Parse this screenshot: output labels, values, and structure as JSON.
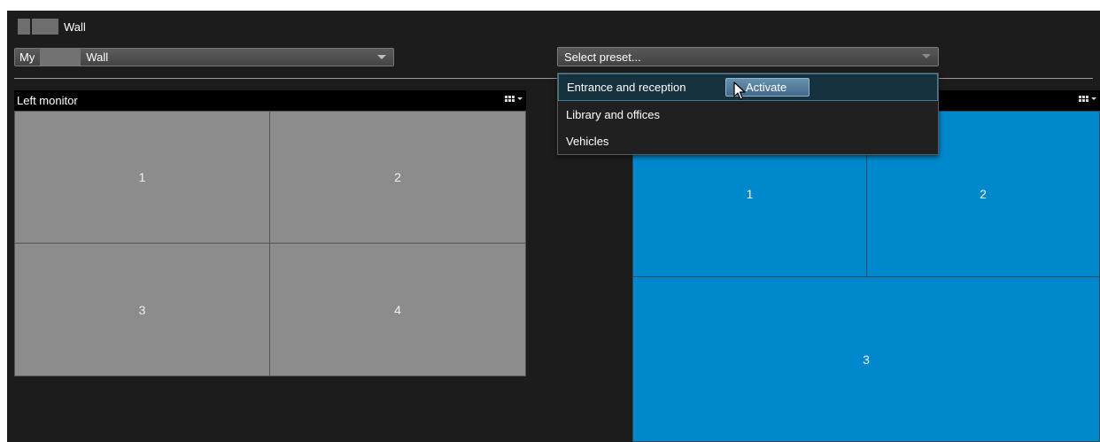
{
  "header": {
    "title": "Wall"
  },
  "wall_select": {
    "prefix": "My",
    "suffix": "Wall"
  },
  "preset_select": {
    "placeholder": "Select preset...",
    "options": [
      {
        "label": "Entrance and reception",
        "highlighted": true
      },
      {
        "label": "Library and offices"
      },
      {
        "label": "Vehicles"
      }
    ],
    "activate_label": "Activate"
  },
  "left_monitor": {
    "title": "Left monitor",
    "cells": [
      "1",
      "2",
      "3",
      "4"
    ]
  },
  "right_monitor": {
    "cells": [
      "1",
      "2",
      "3"
    ]
  },
  "colors": {
    "background": "#1c1c1c",
    "left_cell": "#8c8c8c",
    "right_cell": "#0088cc",
    "highlight": "#16323f",
    "activate": "#4f7898"
  }
}
